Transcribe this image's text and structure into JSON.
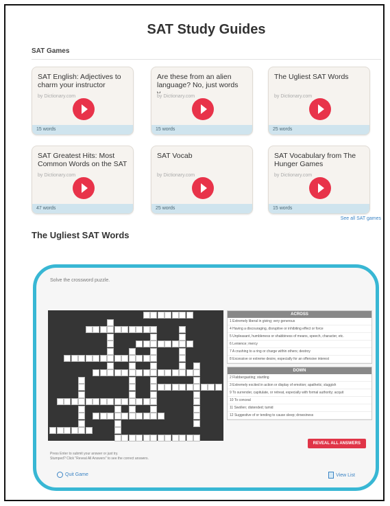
{
  "page": {
    "title": "SAT Study Guides"
  },
  "games_section": {
    "label": "SAT Games",
    "see_all": "See all SAT games"
  },
  "cards": [
    {
      "title": "SAT English: Adjectives to charm your instructor",
      "by": "by Dictionary.com",
      "count": "15 words"
    },
    {
      "title": "Are these from an alien language? No, just words y...",
      "by": "by Dictionary.com",
      "count": "15 words"
    },
    {
      "title": "The Ugliest SAT Words",
      "by": "by Dictionary.com",
      "count": "25 words"
    },
    {
      "title": "SAT Greatest Hits: Most Common Words on the SAT",
      "by": "by Dictionary.com",
      "count": "47 words"
    },
    {
      "title": "SAT Vocab",
      "by": "by Dictionary.com",
      "count": "25 words"
    },
    {
      "title": "SAT Vocabulary from The Hunger Games",
      "by": "by Dictionary.com",
      "count": "15 words"
    }
  ],
  "game": {
    "title": "The Ugliest SAT Words",
    "instructions": "Solve the crossword puzzle.",
    "across_label": "ACROSS",
    "down_label": "DOWN",
    "across": [
      "1  Extremely liberal in giving; very generous",
      "4  Having a discouraging, disruptive or inhibiting effect or force",
      "5  Unpleasant, humbleness or shabbiness of means, speech, character, etc.",
      "6  Lenience; mercy",
      "7  A crushing to a ring or charge within others; destroy",
      "8  Excessive or extreme desire, especially for an offensive interest"
    ],
    "down": [
      "2  Flabbergasting; startling",
      "3  Extremely excited in action or display of emotion; apathetic; sluggish",
      "9  To surrender, capitulate, or retreat, especially with formal authority; acquit",
      "10  To conceal",
      "11  Swollen; distended; tumid",
      "12  Suggestive of or tending to cause sleep; drowsiness"
    ],
    "reveal_button": "REVEAL ALL ANSWERS",
    "bottom_instructions_1": "Press Enter to submit your answer or just try.",
    "bottom_instructions_2": "Stumped? Click \"Reveal All Answers\" to see the correct answers.",
    "quit_label": "Quit Game",
    "list_label": "View List"
  },
  "colors": {
    "accent": "#e8334a",
    "frame": "#38b7d4",
    "link": "#3a83c4"
  }
}
